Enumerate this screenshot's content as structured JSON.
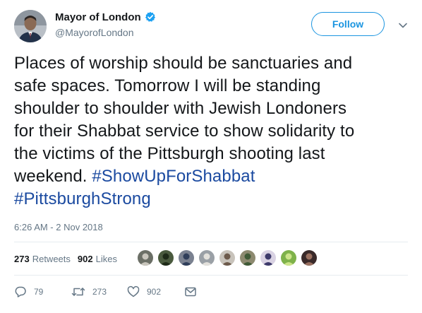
{
  "header": {
    "display_name": "Mayor of London",
    "handle": "@MayorofLondon",
    "follow_label": "Follow",
    "verified": true
  },
  "tweet": {
    "lines": [
      [
        {
          "text": "Places of worship should be sanctuaries and",
          "type": "text"
        }
      ],
      [
        {
          "text": "safe spaces. Tomorrow I will be standing",
          "type": "text"
        }
      ],
      [
        {
          "text": "shoulder to shoulder with Jewish Londoners",
          "type": "text"
        }
      ],
      [
        {
          "text": "for their Shabbat service to show solidarity to",
          "type": "text"
        }
      ],
      [
        {
          "text": "the victims of the Pittsburgh shooting last",
          "type": "text"
        }
      ],
      [
        {
          "text": "weekend. ",
          "type": "text"
        },
        {
          "text": "#ShowUpForShabbat",
          "type": "hashtag"
        }
      ],
      [
        {
          "text": "#PittsburghStrong",
          "type": "hashtag"
        }
      ]
    ],
    "timestamp": "6:26 AM - 2 Nov 2018"
  },
  "stats": {
    "retweets_count": "273",
    "retweets_label": "Retweets",
    "likes_count": "902",
    "likes_label": "Likes"
  },
  "liker_avatars": [
    {
      "bg": "#6b6f66",
      "fg": "#c9c6bd"
    },
    {
      "bg": "#4a5a3e",
      "fg": "#1e2a18"
    },
    {
      "bg": "#7a8190",
      "fg": "#2f3e5a"
    },
    {
      "bg": "#9aa0a6",
      "fg": "#e3e1dc"
    },
    {
      "bg": "#c8c3bb",
      "fg": "#6d5a4b"
    },
    {
      "bg": "#8d8a70",
      "fg": "#3f5a36"
    },
    {
      "bg": "#d9d2e3",
      "fg": "#3d3a6b"
    },
    {
      "bg": "#7fb24a",
      "fg": "#cde58a"
    },
    {
      "bg": "#3a2a2a",
      "fg": "#9a7060"
    }
  ],
  "actions": {
    "reply_count": "79",
    "retweet_count": "273",
    "like_count": "902"
  },
  "colors": {
    "accent": "#1b95e0",
    "hashtag": "#1b4aa0",
    "muted": "#657786",
    "text": "#14171a"
  }
}
